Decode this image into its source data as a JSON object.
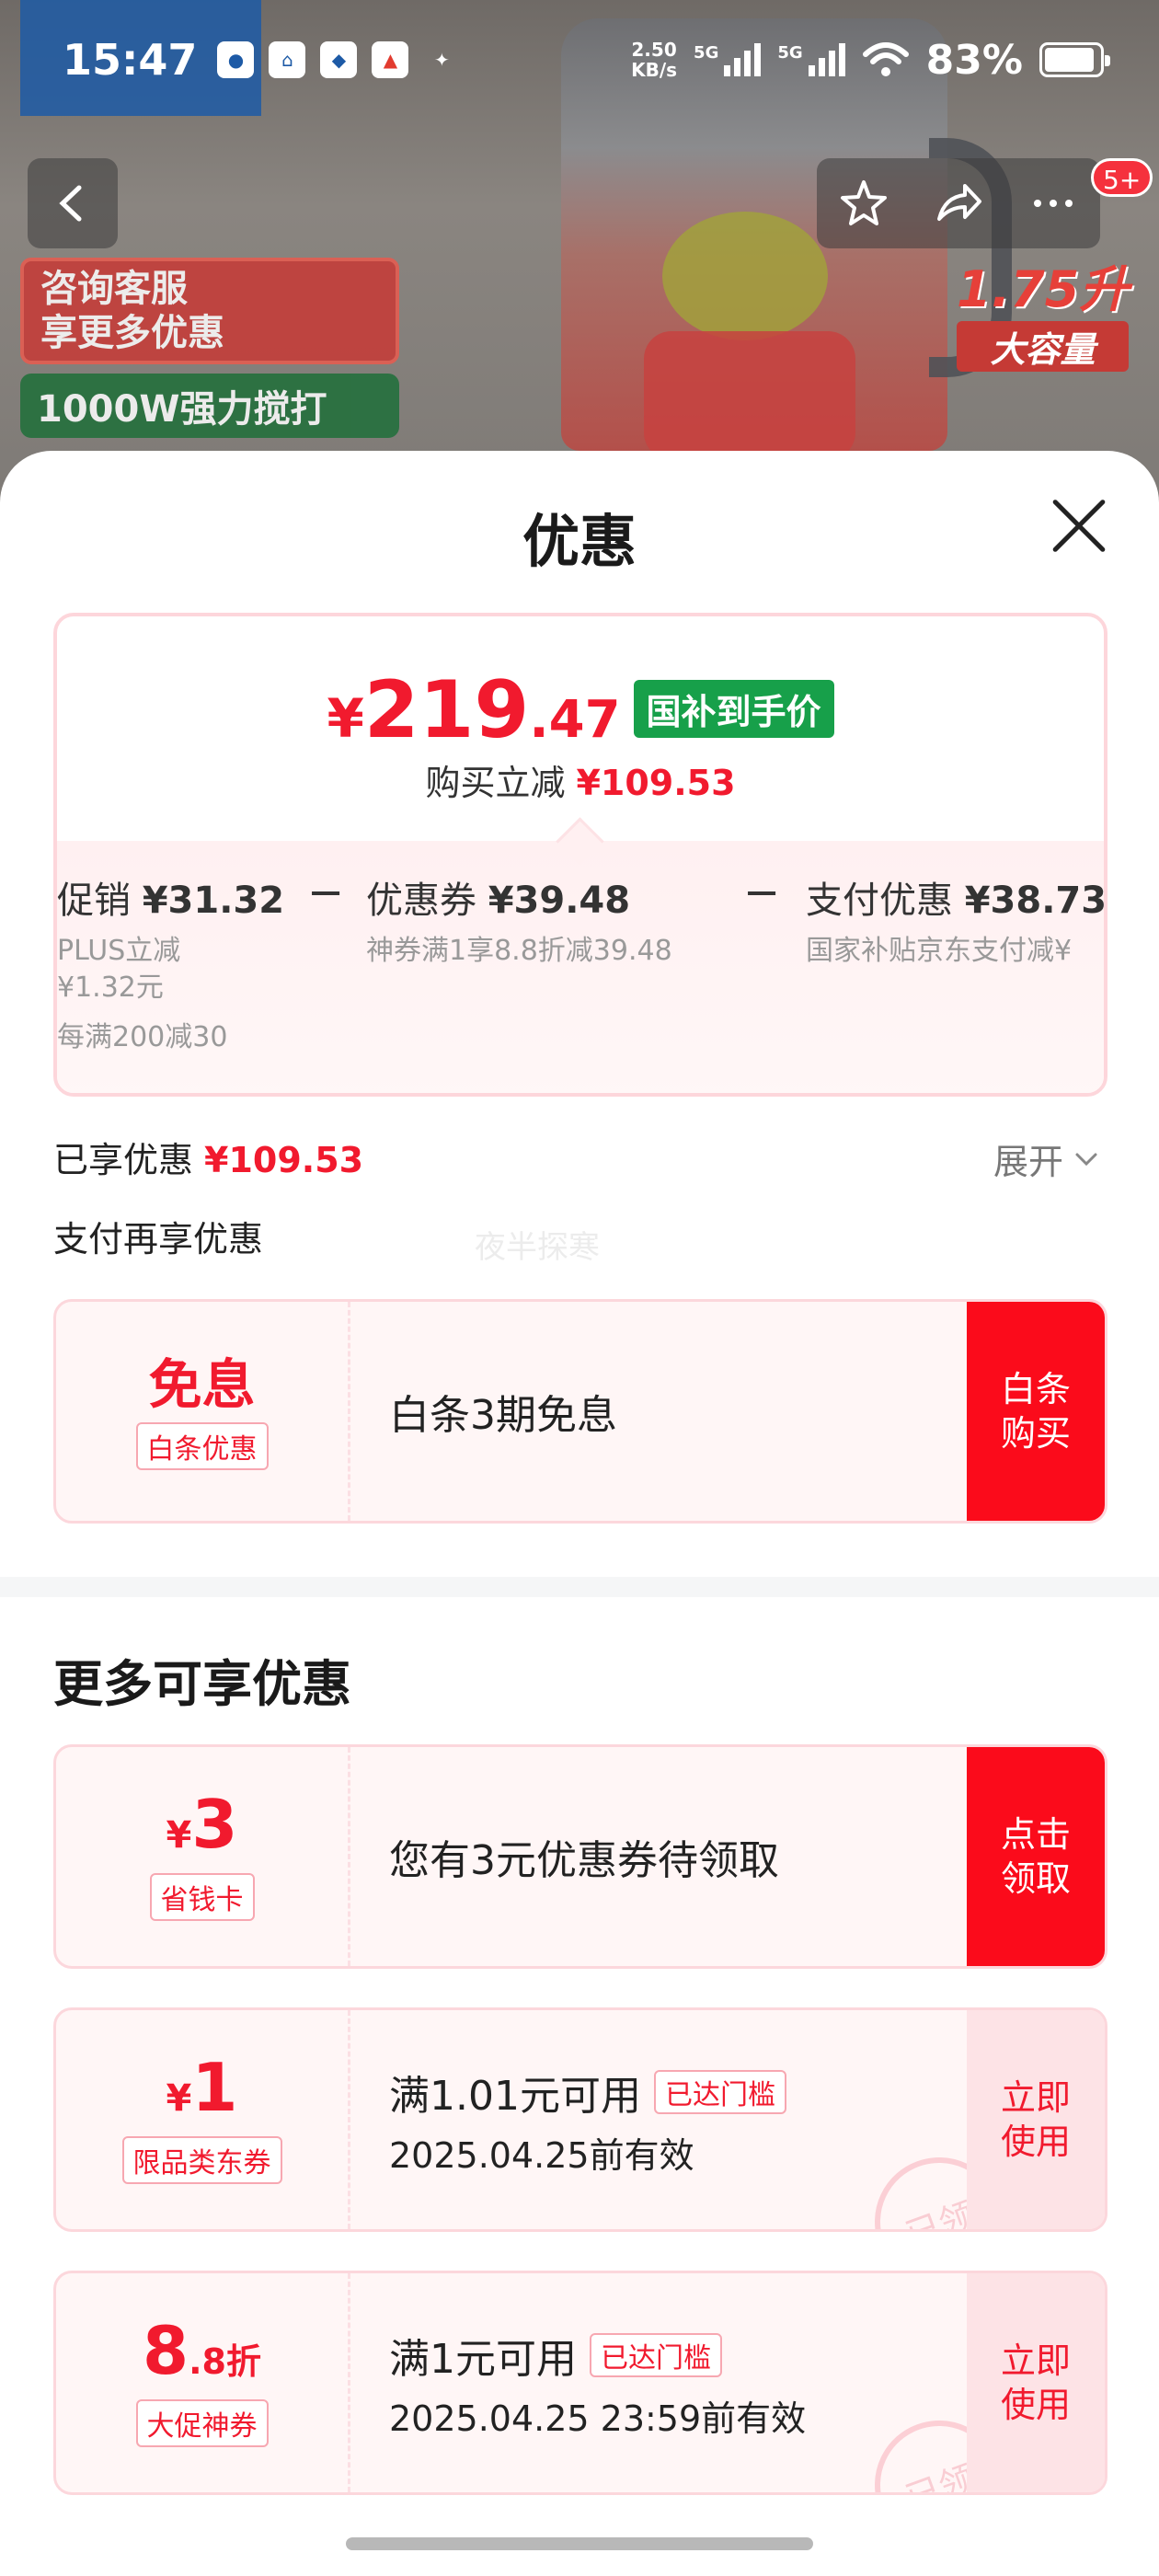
{
  "status_bar": {
    "time": "15:47",
    "net_speed_value": "2.50",
    "net_speed_unit": "KB/s",
    "signal1_label": "5G",
    "signal2_label": "5G",
    "battery": "83%"
  },
  "background": {
    "badge_service": "咨询客服\n享更多优惠",
    "badge_power": "1000W强力搅打",
    "capacity_value": "1.75升",
    "capacity_label": "大容量",
    "messages_count": "5+"
  },
  "sheet": {
    "title": "优惠",
    "price": {
      "symbol": "¥",
      "integer": "219",
      "decimal": ".47",
      "tag": "国补到手价",
      "sub_label": "购买立减",
      "sub_value": "¥109.53"
    },
    "discounts": [
      {
        "label": "促销",
        "value": "¥31.32",
        "notes": [
          "PLUS立减",
          "¥1.32元",
          "每满200减30"
        ]
      },
      {
        "label": "优惠券",
        "value": "¥39.48",
        "notes": [
          "神券满1享8.8折减39.48"
        ]
      },
      {
        "label": "支付优惠",
        "value": "¥38.73",
        "notes": [
          "国家补贴京东支付减¥"
        ]
      }
    ],
    "minus_sign": "−",
    "enjoyed_label": "已享优惠",
    "enjoyed_value": "¥109.53",
    "expand_label": "展开",
    "pay_more_label": "支付再享优惠",
    "watermark": "夜半探寒",
    "pay_coupon": {
      "value": "免息",
      "type": "白条优惠",
      "desc": "白条3期免息",
      "action": "白条\n购买"
    },
    "more_title": "更多可享优惠",
    "more_coupons": [
      {
        "currency": "¥",
        "value": "3",
        "type": "省钱卡",
        "desc": "您有3元优惠券待领取",
        "action": "点击\n领取"
      },
      {
        "currency": "¥",
        "value": "1",
        "type": "限品类东券",
        "line1": "满1.01元可用",
        "tag": "已达门槛",
        "line2": "2025.04.25前有效",
        "action": "立即\n使用",
        "stamp": "已领"
      },
      {
        "value": "8",
        "value_small": ".8折",
        "type": "大促神券",
        "line1": "满1元可用",
        "tag": "已达门槛",
        "line2": "2025.04.25 23:59前有效",
        "action": "立即\n使用",
        "stamp": "已领"
      }
    ]
  },
  "colors": {
    "accent_red": "#f11a2e",
    "button_red": "#fb0b1b",
    "green_tag": "#17a04a"
  }
}
